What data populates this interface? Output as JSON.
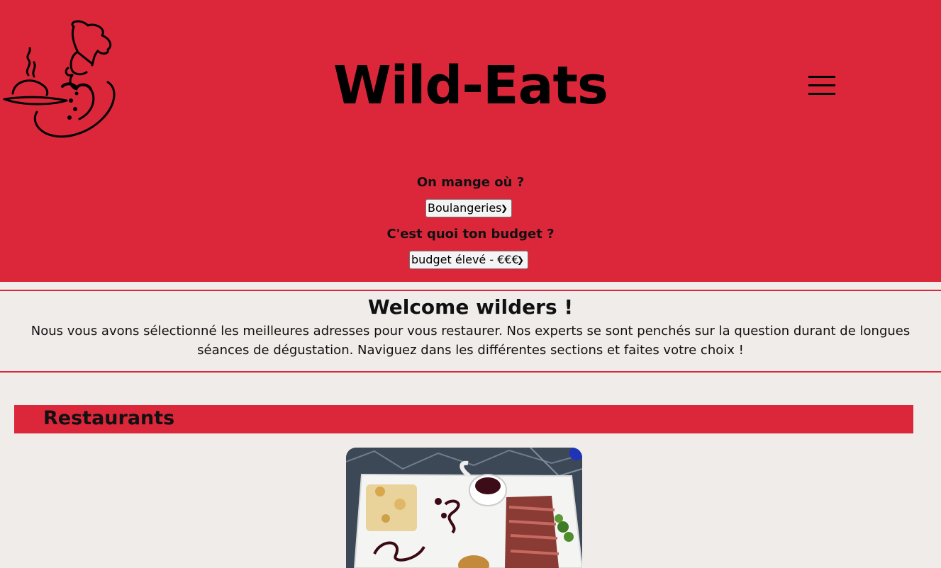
{
  "header": {
    "title": "Wild-Eats",
    "logo_icon": "chef-waiter-icon",
    "menu_icon": "hamburger-menu-icon",
    "background_color": "#dc273b"
  },
  "filters": {
    "where_label": "On mange où ?",
    "where_selected": "Boulangeries",
    "budget_label": "C'est quoi ton budget ?",
    "budget_selected": "budget élevé - €€€"
  },
  "welcome": {
    "title": "Welcome wilders !",
    "text": "Nous vous avons sélectionné les meilleures adresses pour vous restaurer. Nos experts se sont penchés sur la question durant de longues séances de dégustation. Naviguez dans les différentes sections et faites votre choix !"
  },
  "section": {
    "title": "Restaurants"
  },
  "card": {
    "image_icon": "steak-dish-photo"
  }
}
